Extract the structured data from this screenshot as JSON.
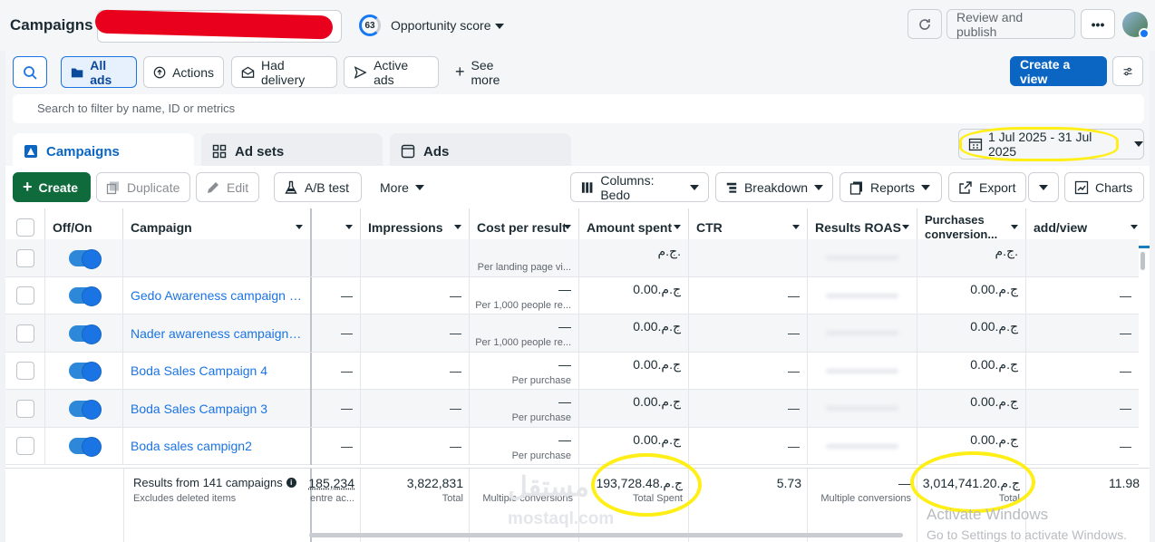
{
  "topbar": {
    "title": "Campaigns",
    "opportunity_score": "63",
    "opportunity_label": "Opportunity score",
    "review_publish": "Review and publish",
    "more": "•••"
  },
  "filters": {
    "all_ads": "All ads",
    "actions": "Actions",
    "had_delivery": "Had delivery",
    "active_ads": "Active ads",
    "see_more": "See more",
    "create_view": "Create a view",
    "search_placeholder": "Search to filter by name, ID or metrics"
  },
  "tabs": [
    "Campaigns",
    "Ad sets",
    "Ads"
  ],
  "date_range": "1 Jul 2025 - 31 Jul 2025",
  "toolbar": {
    "create": "Create",
    "duplicate": "Duplicate",
    "edit": "Edit",
    "ab_test": "A/B test",
    "more": "More",
    "columns": "Columns: Bedo",
    "breakdown": "Breakdown",
    "reports": "Reports",
    "export": "Export",
    "charts": "Charts"
  },
  "columns": {
    "off_on": "Off/On",
    "campaign": "Campaign",
    "impressions": "Impressions",
    "cost_per_result": "Cost per result",
    "amount_spent": "Amount spent",
    "ctr": "CTR",
    "results_roas": "Results ROAS",
    "purchases_conversion_1": "Purchases",
    "purchases_conversion_2": "conversion...",
    "add_view": "add/view"
  },
  "rows": [
    {
      "name": "",
      "dash1": "",
      "dash2": "",
      "cpr": "",
      "cpr_sub": "Per landing page vi...",
      "spent": "ج.م.",
      "ctr": "",
      "purch": "ج.م."
    },
    {
      "name": "Gedo Awareness campaign 30...",
      "dash1": "—",
      "dash2": "—",
      "cpr": "—",
      "cpr_sub": "Per 1,000 people re...",
      "spent": "ج.م.0.00",
      "ctr": "—",
      "purch": "ج.م.0.00"
    },
    {
      "name": "Nader awareness campaign 30...",
      "dash1": "—",
      "dash2": "—",
      "cpr": "—",
      "cpr_sub": "Per 1,000 people re...",
      "spent": "ج.م.0.00",
      "ctr": "—",
      "purch": "ج.م.0.00"
    },
    {
      "name": "Boda Sales Campaign 4",
      "dash1": "—",
      "dash2": "—",
      "cpr": "—",
      "cpr_sub": "Per purchase",
      "spent": "ج.م.0.00",
      "ctr": "—",
      "purch": "ج.م.0.00"
    },
    {
      "name": "Boda Sales Campaign 3",
      "dash1": "—",
      "dash2": "—",
      "cpr": "—",
      "cpr_sub": "Per purchase",
      "spent": "ج.م.0.00",
      "ctr": "—",
      "purch": "ج.م.0.00"
    },
    {
      "name": "Boda sales campign2",
      "dash1": "—",
      "dash2": "—",
      "cpr": "—",
      "cpr_sub": "Per purchase",
      "spent": "ج.م.0.00",
      "ctr": "—",
      "purch": "ج.م.0.00"
    }
  ],
  "row_extra_dash": "—",
  "footer": {
    "results": "Results from 141 campaigns",
    "excludes": "Excludes deleted items",
    "reach_val": "185,234",
    "reach_sub": "entre ac...",
    "impressions": "3,822,831",
    "impressions_sub": "Total",
    "cpr_sub": "Multiple conversions",
    "spent": "ج.م.193,728.48",
    "spent_sub": "Total Spent",
    "ctr": "5.73",
    "roas": "—",
    "roas_sub": "Multiple conversions",
    "purch": "ج.م.3,014,741.20",
    "purch_sub": "Total",
    "add_view": "11.98"
  },
  "watermark": {
    "activate": "Activate Windows",
    "settings": "Go to Settings to activate Windows.",
    "mostaql_ar": "مستقل",
    "mostaql": "mostaql.com"
  },
  "colors": {
    "primary": "#0a66c2",
    "create": "#0f6a3c",
    "link": "#1b74e4",
    "highlight": "#ffef17"
  }
}
